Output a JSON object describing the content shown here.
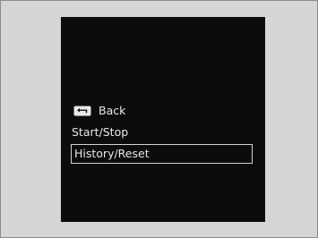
{
  "menu": {
    "items": [
      {
        "label": "Back",
        "icon": "back-arrow-icon",
        "selected": false
      },
      {
        "label": "Start/Stop",
        "selected": false
      },
      {
        "label": "History/Reset",
        "selected": true
      }
    ]
  },
  "colors": {
    "panel_background": "#d6d6d6",
    "screen_background": "#0c0c0c",
    "text": "#e8e8e8",
    "selection_border": "#d4d4d4"
  }
}
